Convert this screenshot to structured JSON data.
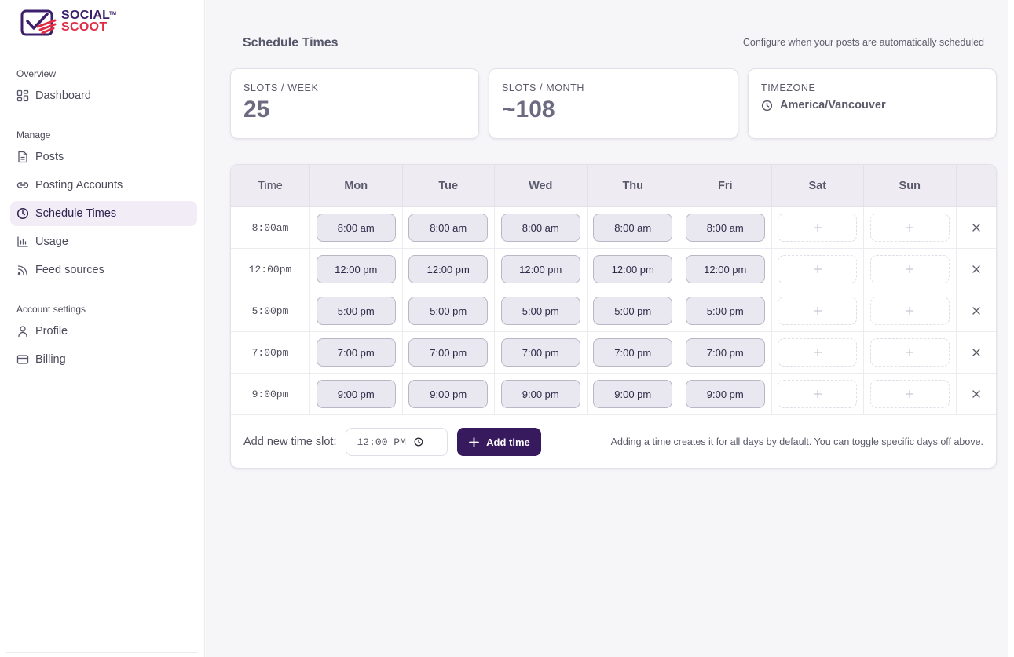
{
  "brand": {
    "line1": "SOCIAL",
    "line2": "SCOOT",
    "tm": "TM",
    "primary_color": "#3b1f6b",
    "accent_color": "#e02d45"
  },
  "sidebar": {
    "sections": [
      {
        "title": "Overview",
        "items": [
          {
            "label": "Dashboard",
            "icon": "dashboard-icon"
          }
        ]
      },
      {
        "title": "Manage",
        "items": [
          {
            "label": "Posts",
            "icon": "document-icon"
          },
          {
            "label": "Posting Accounts",
            "icon": "link-icon"
          },
          {
            "label": "Schedule Times",
            "icon": "clock-icon",
            "active": true
          },
          {
            "label": "Usage",
            "icon": "bar-chart-icon"
          },
          {
            "label": "Feed sources",
            "icon": "rss-icon"
          }
        ]
      },
      {
        "title": "Account settings",
        "items": [
          {
            "label": "Profile",
            "icon": "user-icon"
          },
          {
            "label": "Billing",
            "icon": "credit-card-icon"
          }
        ]
      }
    ]
  },
  "header": {
    "title": "Schedule Times",
    "description": "Configure when your posts are automatically scheduled"
  },
  "stats": {
    "slots_week": {
      "label": "SLOTS / WEEK",
      "value": "25"
    },
    "slots_month": {
      "label": "SLOTS / MONTH",
      "value": "~108"
    },
    "timezone": {
      "label": "TIMEZONE",
      "value": "America/Vancouver"
    }
  },
  "table": {
    "columns": [
      "Time",
      "Mon",
      "Tue",
      "Wed",
      "Thu",
      "Fri",
      "Sat",
      "Sun"
    ],
    "rows": [
      {
        "time": "8:00am",
        "slot": "8:00 am",
        "days": [
          true,
          true,
          true,
          true,
          true,
          false,
          false
        ]
      },
      {
        "time": "12:00pm",
        "slot": "12:00 pm",
        "days": [
          true,
          true,
          true,
          true,
          true,
          false,
          false
        ]
      },
      {
        "time": "5:00pm",
        "slot": "5:00 pm",
        "days": [
          true,
          true,
          true,
          true,
          true,
          false,
          false
        ]
      },
      {
        "time": "7:00pm",
        "slot": "7:00 pm",
        "days": [
          true,
          true,
          true,
          true,
          true,
          false,
          false
        ]
      },
      {
        "time": "9:00pm",
        "slot": "9:00 pm",
        "days": [
          true,
          true,
          true,
          true,
          true,
          false,
          false
        ]
      }
    ]
  },
  "add_slot": {
    "label": "Add new time slot:",
    "input_value": "12:00 PM",
    "button_label": "Add time",
    "hint": "Adding a time creates it for all days by default. You can toggle specific days off above."
  }
}
